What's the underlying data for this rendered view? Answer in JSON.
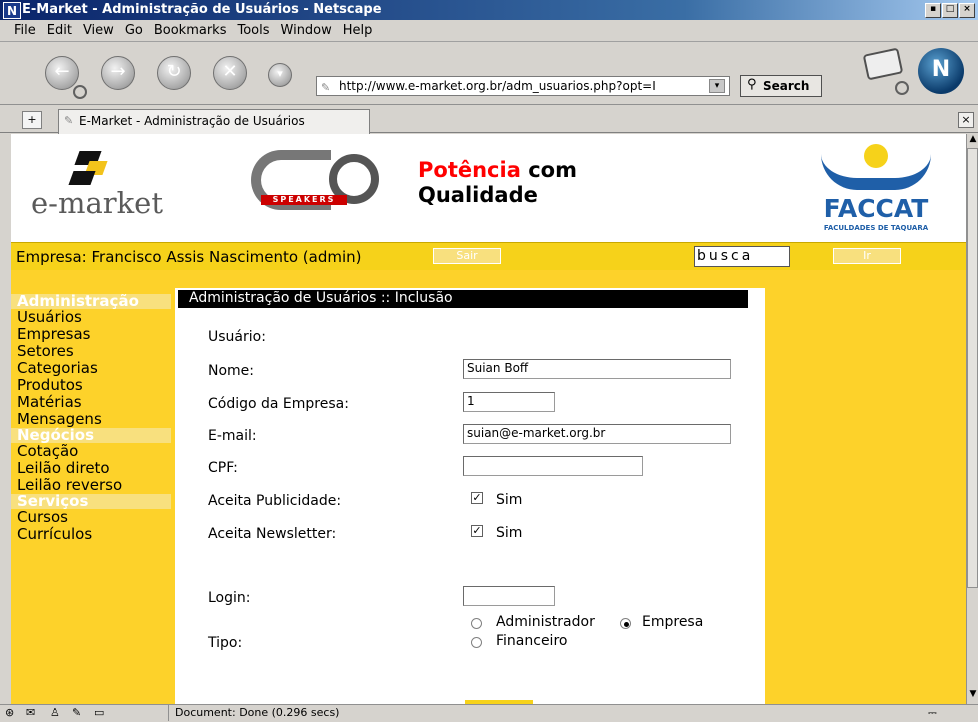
{
  "window": {
    "title": "E-Market - Administração de Usuários - Netscape"
  },
  "menu": [
    "File",
    "Edit",
    "View",
    "Go",
    "Bookmarks",
    "Tools",
    "Window",
    "Help"
  ],
  "toolbar": {
    "url": "http://www.e-market.org.br/adm_usuarios.php?opt=I",
    "search_label": "Search"
  },
  "tab": {
    "label": "E-Market - Administração de Usuários"
  },
  "header": {
    "logo_text": "e-market",
    "sponsor_text": "SPEAKERS",
    "slogan_red": "Potência",
    "slogan_rest": "com",
    "slogan_line2": "Qualidade",
    "faccat_text": "FACCAT",
    "faccat_sub": "FACULDADES DE TAQUARA"
  },
  "userbar": {
    "empresa": "Empresa: Francisco Assis Nascimento (admin)",
    "sair": "Sair",
    "busca_value": "busca",
    "ir": "Ir"
  },
  "sidebar": {
    "administracao": "Administração",
    "admin_items": [
      "Usuários",
      "Empresas",
      "Setores",
      "Categorias",
      "Produtos",
      "Matérias",
      "Mensagens"
    ],
    "negocios": "Negócios",
    "negocios_items": [
      "Cotação",
      "Leilão direto",
      "Leilão reverso"
    ],
    "servicos": "Serviços",
    "servicos_items": [
      "Cursos",
      "Currículos"
    ]
  },
  "form": {
    "heading": "Administração de Usuários :: Inclusão",
    "usuario_label": "Usuário:",
    "nome_label": "Nome:",
    "nome_value": "Suian Boff",
    "codigo_label": "Código da Empresa:",
    "codigo_value": "1",
    "email_label": "E-mail:",
    "email_value": "suian@e-market.org.br",
    "cpf_label": "CPF:",
    "cpf_value": "",
    "publicidade_label": "Aceita Publicidade:",
    "publicidade_option": "Sim",
    "newsletter_label": "Aceita Newsletter:",
    "newsletter_option": "Sim",
    "login_label": "Login:",
    "login_value": "",
    "tipo_label": "Tipo:",
    "tipo_options": [
      "Administrador",
      "Empresa",
      "Financeiro"
    ]
  },
  "status": {
    "text": "Document: Done (0.296 secs)"
  }
}
